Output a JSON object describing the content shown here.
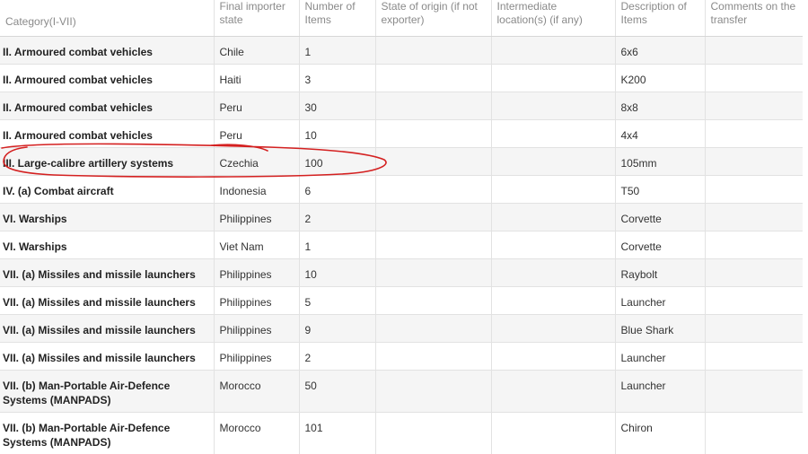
{
  "table": {
    "headers": [
      "Category(I-VII)",
      "Final importer state",
      "Number of Items",
      "State of origin (if not exporter)",
      "Intermediate location(s) (if any)",
      "Description of Items",
      "Comments on the transfer"
    ],
    "rows": [
      {
        "category": "II. Armoured combat vehicles",
        "importer": "Chile",
        "items": "1",
        "origin": "",
        "intermediate": "",
        "description": "6x6",
        "comments": ""
      },
      {
        "category": "II. Armoured combat vehicles",
        "importer": "Haiti",
        "items": "3",
        "origin": "",
        "intermediate": "",
        "description": "K200",
        "comments": ""
      },
      {
        "category": "II. Armoured combat vehicles",
        "importer": "Peru",
        "items": "30",
        "origin": "",
        "intermediate": "",
        "description": "8x8",
        "comments": ""
      },
      {
        "category": "II. Armoured combat vehicles",
        "importer": "Peru",
        "items": "10",
        "origin": "",
        "intermediate": "",
        "description": "4x4",
        "comments": ""
      },
      {
        "category": "III. Large-calibre artillery systems",
        "importer": "Czechia",
        "items": "100",
        "origin": "",
        "intermediate": "",
        "description": "105mm",
        "comments": ""
      },
      {
        "category": "IV. (a) Combat aircraft",
        "importer": "Indonesia",
        "items": "6",
        "origin": "",
        "intermediate": "",
        "description": "T50",
        "comments": ""
      },
      {
        "category": "VI. Warships",
        "importer": "Philippines",
        "items": "2",
        "origin": "",
        "intermediate": "",
        "description": "Corvette",
        "comments": ""
      },
      {
        "category": "VI. Warships",
        "importer": "Viet Nam",
        "items": "1",
        "origin": "",
        "intermediate": "",
        "description": "Corvette",
        "comments": ""
      },
      {
        "category": "VII. (a) Missiles and missile launchers",
        "importer": "Philippines",
        "items": "10",
        "origin": "",
        "intermediate": "",
        "description": "Raybolt",
        "comments": ""
      },
      {
        "category": "VII. (a) Missiles and missile launchers",
        "importer": "Philippines",
        "items": "5",
        "origin": "",
        "intermediate": "",
        "description": "Launcher",
        "comments": ""
      },
      {
        "category": "VII. (a) Missiles and missile launchers",
        "importer": "Philippines",
        "items": "9",
        "origin": "",
        "intermediate": "",
        "description": "Blue Shark",
        "comments": ""
      },
      {
        "category": "VII. (a) Missiles and missile launchers",
        "importer": "Philippines",
        "items": "2",
        "origin": "",
        "intermediate": "",
        "description": "Launcher",
        "comments": ""
      },
      {
        "category": "VII. (b) Man-Portable Air-Defence Systems (MANPADS)",
        "importer": "Morocco",
        "items": "50",
        "origin": "",
        "intermediate": "",
        "description": "Launcher",
        "comments": ""
      },
      {
        "category": "VII. (b) Man-Portable Air-Defence Systems (MANPADS)",
        "importer": "Morocco",
        "items": "101",
        "origin": "",
        "intermediate": "",
        "description": "Chiron",
        "comments": ""
      }
    ]
  },
  "colors": {
    "row_shade": "#f5f5f5",
    "annotation": "#d42020"
  }
}
